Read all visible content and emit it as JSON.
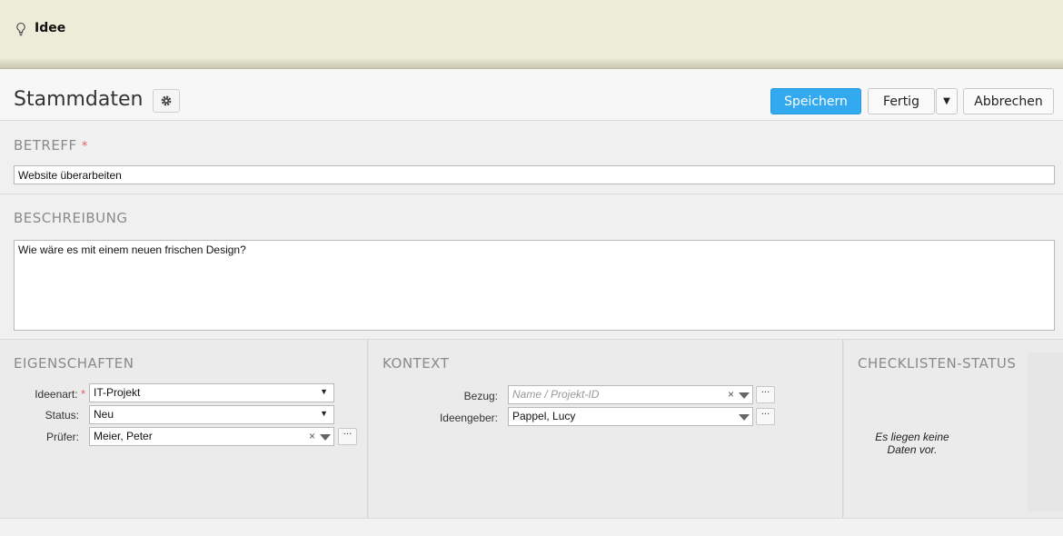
{
  "topbar": {
    "icon": "lightbulb-icon",
    "title": "Idee"
  },
  "header": {
    "title": "Stammdaten",
    "settings_icon": "gear-icon",
    "save_label": "Speichern",
    "done_label": "Fertig",
    "cancel_label": "Abbrechen",
    "colors": {
      "primary": "#33a9f0",
      "required": "#e26060"
    }
  },
  "betreff": {
    "label": "BETREFF",
    "required_mark": "*",
    "value": "Website überarbeiten"
  },
  "beschreibung": {
    "label": "BESCHREIBUNG",
    "value": "Wie wäre es mit einem neuen frischen Design?"
  },
  "eigenschaften": {
    "label": "EIGENSCHAFTEN",
    "ideenart_label": "Ideenart:",
    "ideenart_required": "*",
    "ideenart_value": "IT-Projekt",
    "status_label": "Status:",
    "status_value": "Neu",
    "pruefer_label": "Prüfer:",
    "pruefer_value": "Meier, Peter"
  },
  "kontext": {
    "label": "KONTEXT",
    "bezug_label": "Bezug:",
    "bezug_placeholder": "Name / Projekt-ID",
    "ideengeber_label": "Ideengeber:",
    "ideengeber_value": "Pappel, Lucy"
  },
  "checkliste": {
    "label": "CHECKLISTEN-STATUS",
    "empty_line1": "Es liegen keine",
    "empty_line2": "Daten vor."
  },
  "glyphs": {
    "caret_down": "▼",
    "clear": "×",
    "more": "···"
  }
}
